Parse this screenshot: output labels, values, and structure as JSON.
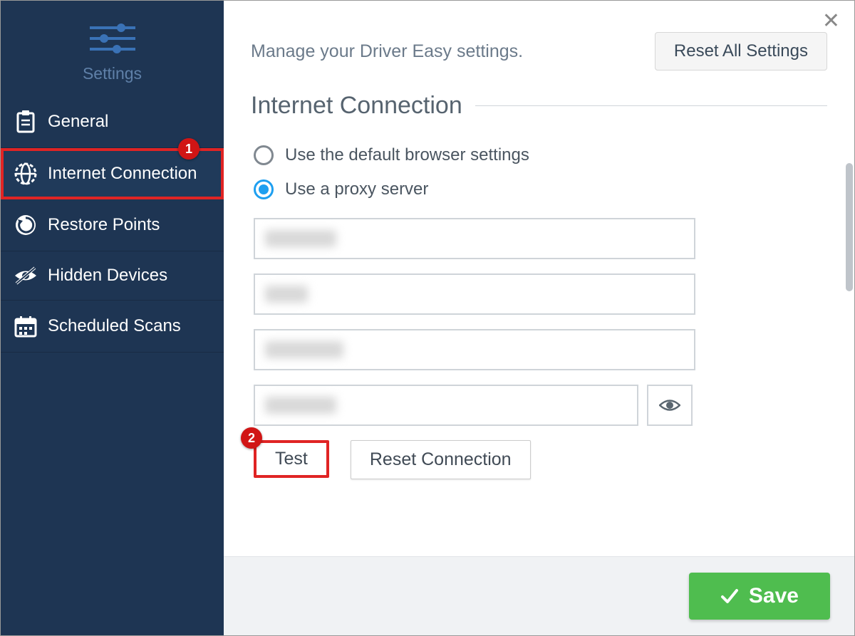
{
  "sidebar": {
    "title": "Settings",
    "items": [
      {
        "label": "General",
        "icon": "clipboard"
      },
      {
        "label": "Internet Connection",
        "icon": "globe",
        "active": true
      },
      {
        "label": "Restore Points",
        "icon": "restore"
      },
      {
        "label": "Hidden Devices",
        "icon": "eye-slash"
      },
      {
        "label": "Scheduled Scans",
        "icon": "calendar"
      }
    ]
  },
  "header": {
    "description": "Manage your Driver Easy settings.",
    "reset_all_label": "Reset All Settings"
  },
  "section": {
    "title": "Internet Connection",
    "radio_default": "Use the default browser settings",
    "radio_proxy": "Use a proxy server",
    "selected": "proxy",
    "fields": {
      "server": "",
      "port": "",
      "username": "",
      "password": ""
    },
    "test_label": "Test",
    "reset_conn_label": "Reset Connection"
  },
  "footer": {
    "save_label": "Save"
  },
  "annotations": {
    "badge1": "1",
    "badge2": "2"
  },
  "colors": {
    "sidebar_bg": "#1e3553",
    "accent_blue": "#1e9ff0",
    "annotation_red": "#d11515",
    "save_green": "#4fbd4f"
  }
}
